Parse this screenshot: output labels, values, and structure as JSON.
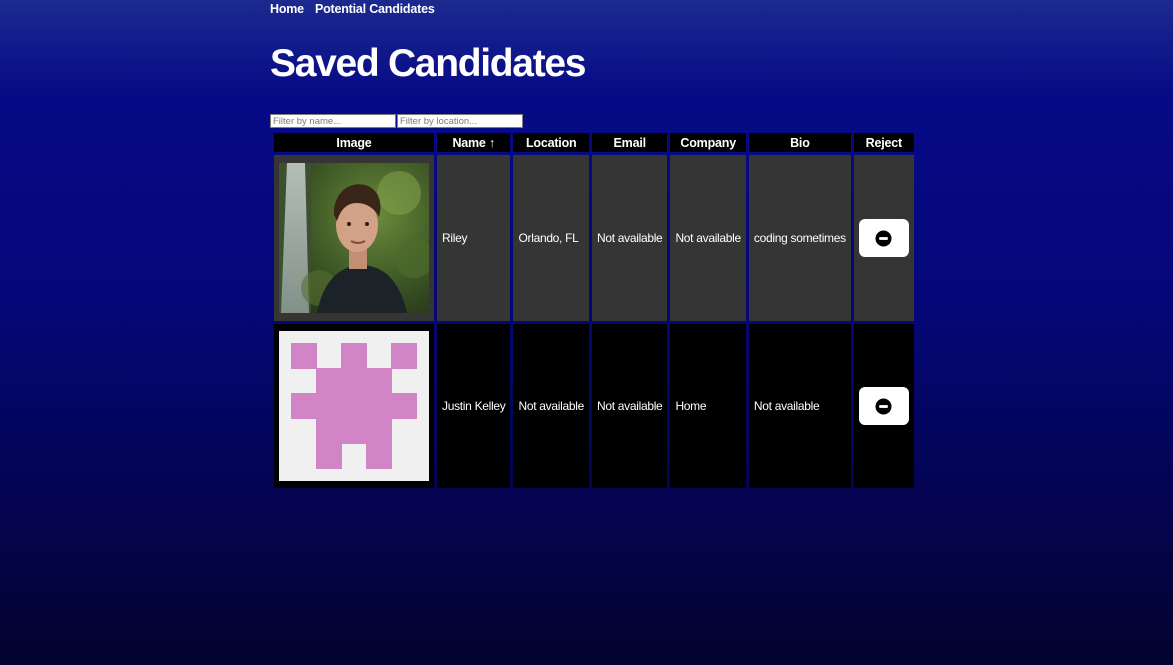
{
  "nav": {
    "home": "Home",
    "potential": "Potential Candidates"
  },
  "page": {
    "title": "Saved Candidates"
  },
  "filters": {
    "name_placeholder": "Filter by name...",
    "location_placeholder": "Filter by location..."
  },
  "table": {
    "headers": {
      "image": "Image",
      "name": "Name ↑",
      "location": "Location",
      "email": "Email",
      "company": "Company",
      "bio": "Bio",
      "reject": "Reject"
    },
    "rows": [
      {
        "name": "Riley",
        "location": "Orlando, FL",
        "email": "Not available",
        "company": "Not available",
        "bio": "coding sometimes",
        "avatar": "photo"
      },
      {
        "name": "Justin Kelley",
        "location": "Not available",
        "email": "Not available",
        "company": "Home",
        "bio": "Not available",
        "avatar": "identicon-pink"
      }
    ]
  },
  "icons": {
    "reject": "minus-circle-icon"
  },
  "colors": {
    "row_alt": "#353535",
    "identicon": "#d185c6"
  }
}
